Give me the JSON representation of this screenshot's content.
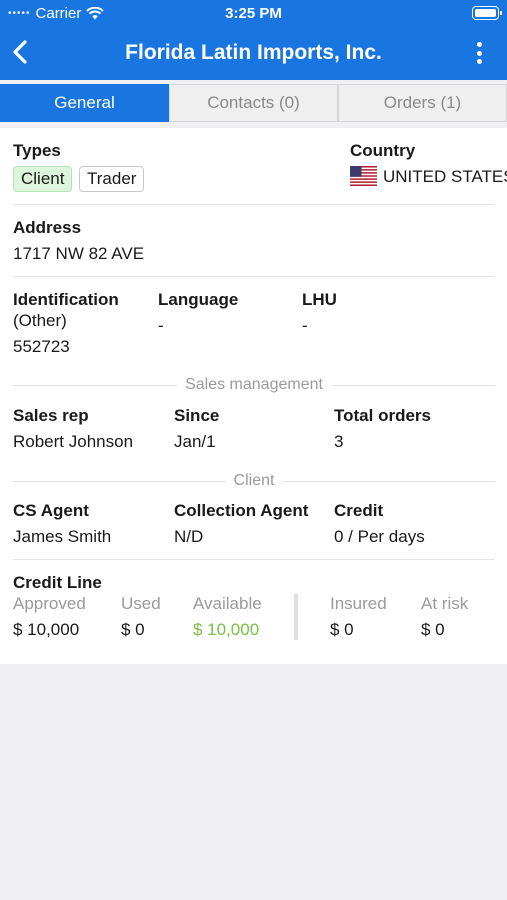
{
  "status_bar": {
    "carrier": "Carrier",
    "time": "3:25 PM"
  },
  "header": {
    "title": "Florida Latin Imports, Inc."
  },
  "tabs": [
    {
      "label": "General"
    },
    {
      "label": "Contacts (0)"
    },
    {
      "label": "Orders (1)"
    }
  ],
  "types": {
    "label": "Types",
    "tags": [
      "Client",
      "Trader"
    ]
  },
  "country": {
    "label": "Country",
    "value": "UNITED STATES"
  },
  "address": {
    "label": "Address",
    "value": "1717 NW 82 AVE"
  },
  "identification": {
    "label": "Identification",
    "sub": "(Other)",
    "value": "552723"
  },
  "language": {
    "label": "Language",
    "value": "-"
  },
  "lhu": {
    "label": "LHU",
    "value": "-"
  },
  "sales_management": {
    "section_title": "Sales management",
    "sales_rep": {
      "label": "Sales rep",
      "value": "Robert Johnson"
    },
    "since": {
      "label": "Since",
      "value": "Jan/1"
    },
    "total_orders": {
      "label": "Total orders",
      "value": "3"
    }
  },
  "client": {
    "section_title": "Client",
    "cs_agent": {
      "label": "CS Agent",
      "value": "James Smith"
    },
    "collection_agent": {
      "label": "Collection Agent",
      "value": "N/D"
    },
    "credit": {
      "label": "Credit",
      "value": "0 / Per days"
    }
  },
  "credit_line": {
    "label": "Credit Line",
    "approved": {
      "label": "Approved",
      "value": "$ 10,000"
    },
    "used": {
      "label": "Used",
      "value": "$ 0"
    },
    "available": {
      "label": "Available",
      "value": "$ 10,000"
    },
    "insured": {
      "label": "Insured",
      "value": "$ 0"
    },
    "at_risk": {
      "label": "At risk",
      "value": "$ 0"
    }
  },
  "colors": {
    "accent": "#1976e0",
    "available_green": "#76c043",
    "client_tag_bg": "#dcf5dc"
  }
}
